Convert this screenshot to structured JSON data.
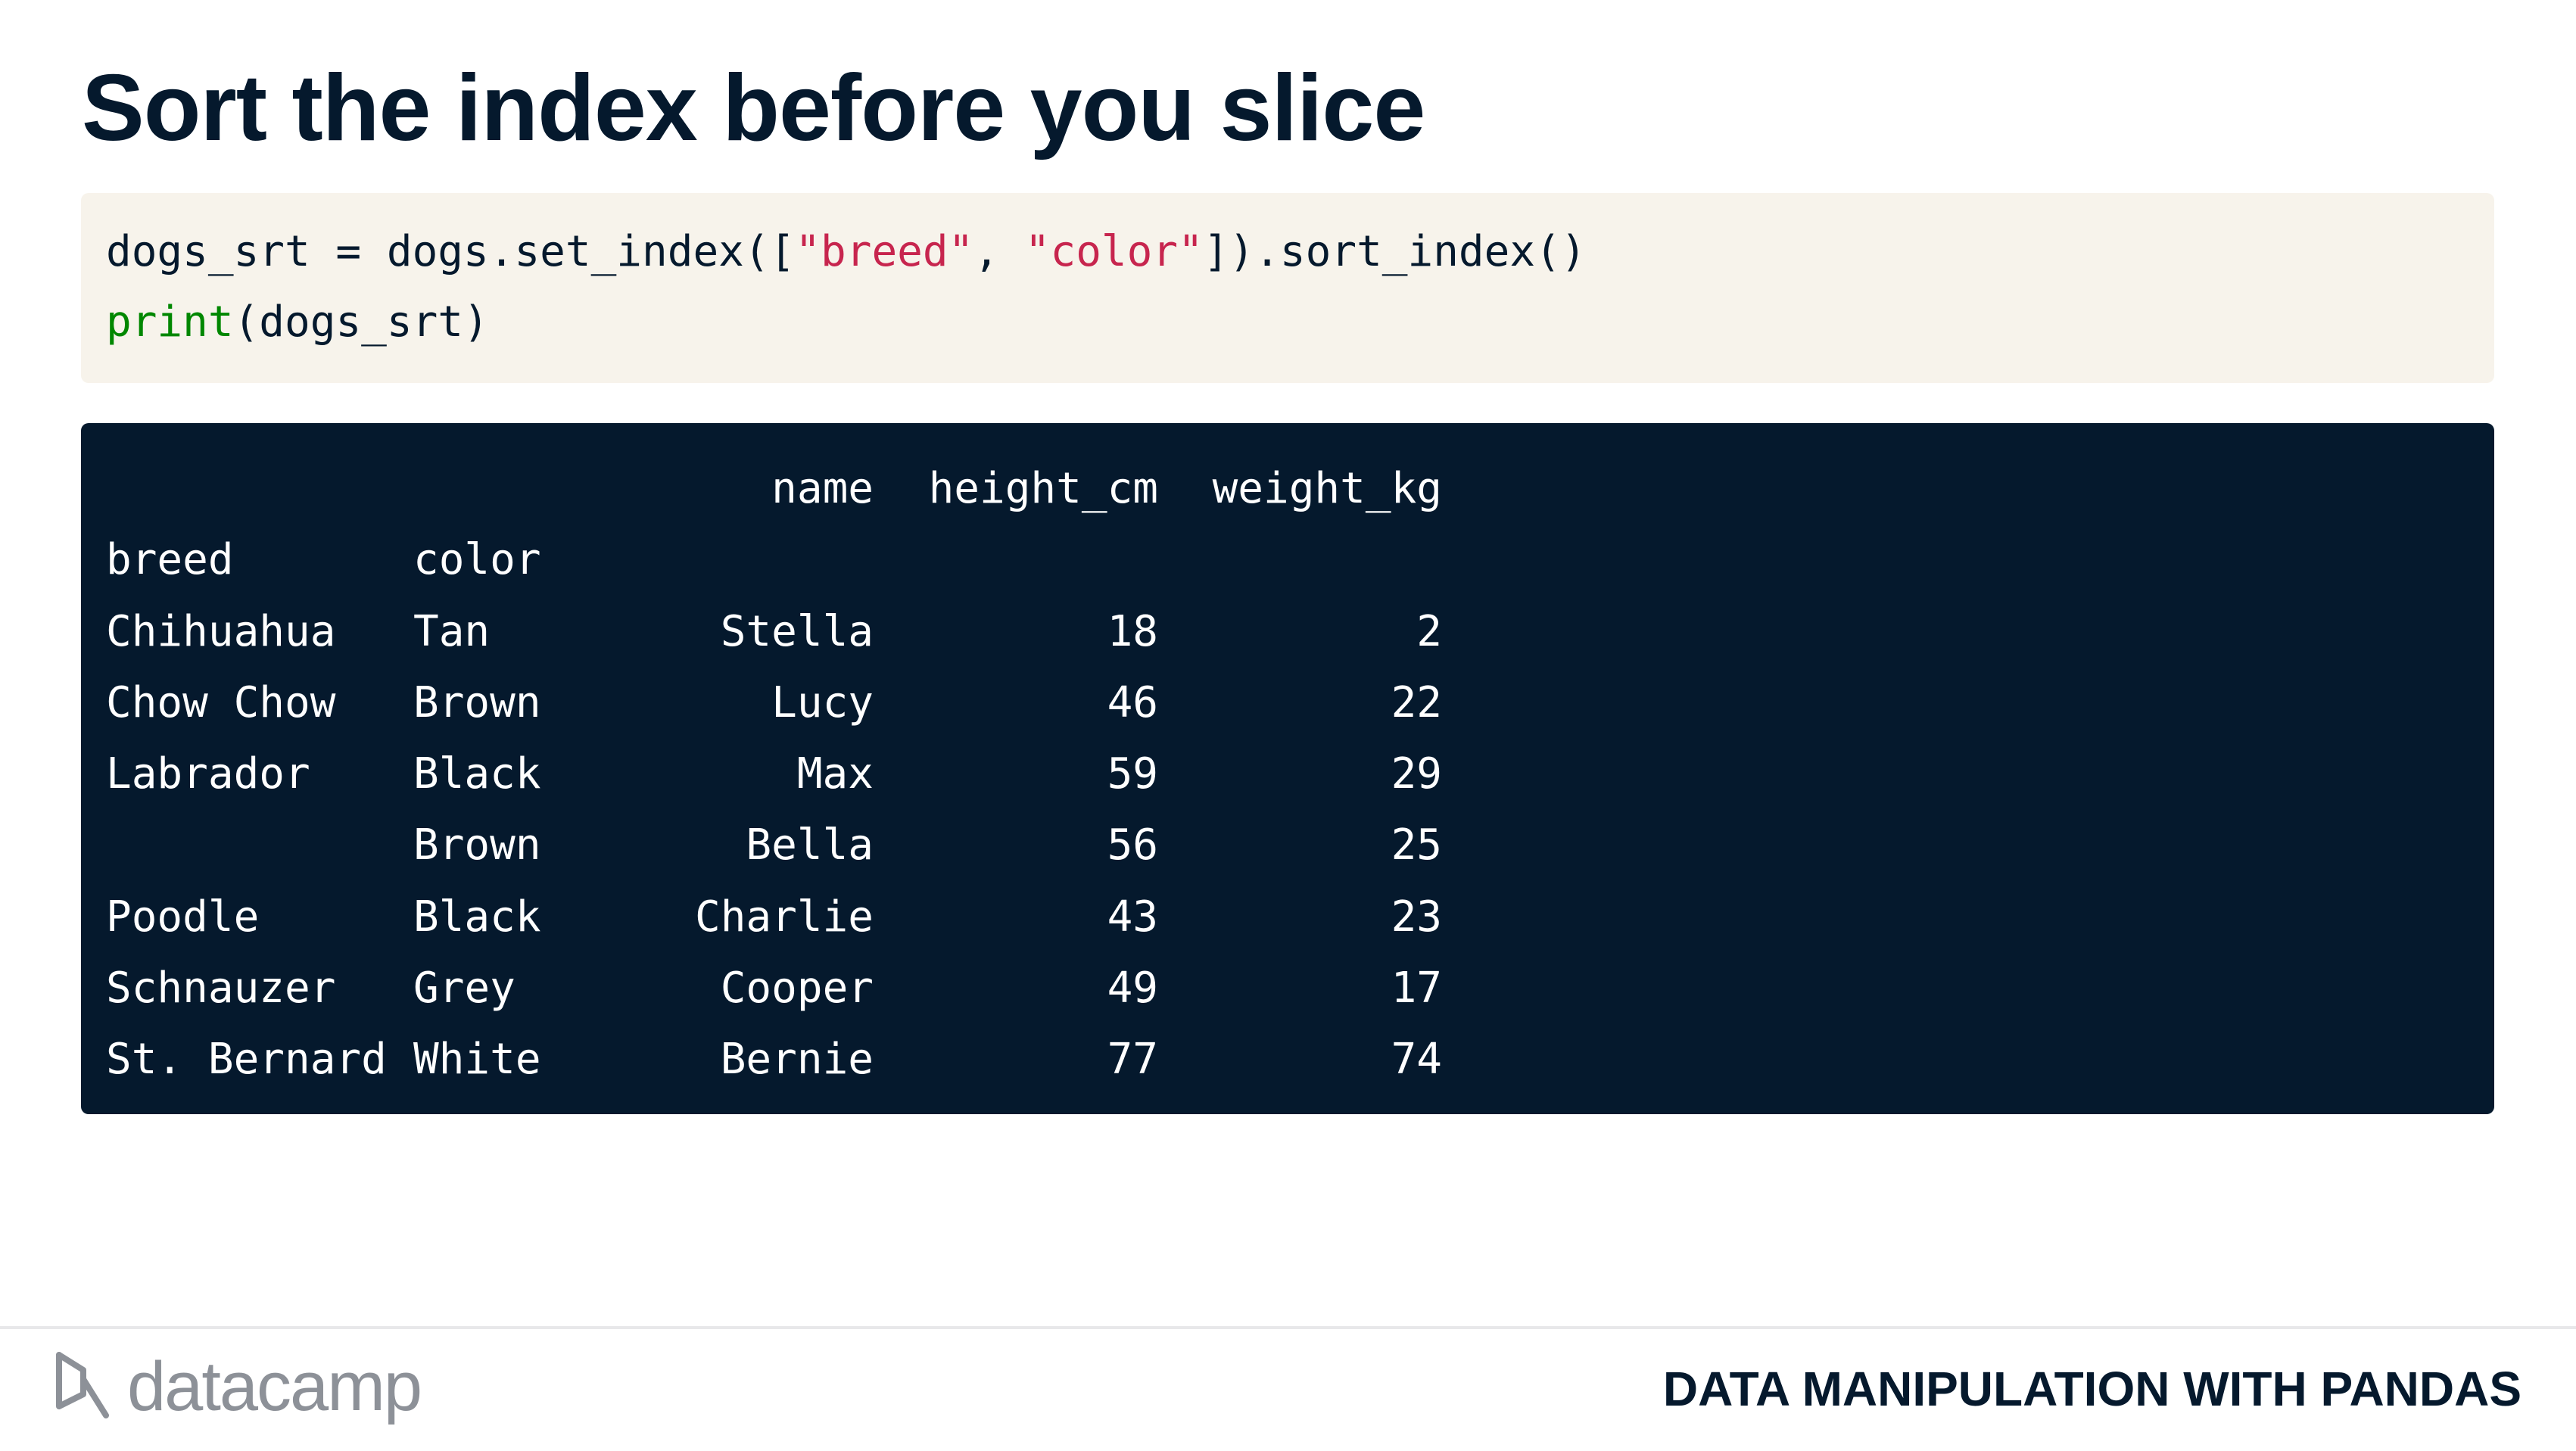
{
  "slide": {
    "title": "Sort the index before you slice"
  },
  "code": {
    "line1": {
      "pre": "dogs_srt = dogs.set_index([",
      "str1": "\"breed\"",
      "mid": ", ",
      "str2": "\"color\"",
      "post": "]).sort_index()"
    },
    "line2": {
      "kw": "print",
      "rest": "(dogs_srt)"
    }
  },
  "output": {
    "header": {
      "name": "name",
      "height_cm": "height_cm",
      "weight_kg": "weight_kg"
    },
    "index_header": {
      "breed": "breed",
      "color": "color"
    },
    "rows": [
      {
        "breed": "Chihuahua",
        "color": "Tan",
        "name": "Stella",
        "height_cm": "18",
        "weight_kg": "2"
      },
      {
        "breed": "Chow Chow",
        "color": "Brown",
        "name": "Lucy",
        "height_cm": "46",
        "weight_kg": "22"
      },
      {
        "breed": "Labrador",
        "color": "Black",
        "name": "Max",
        "height_cm": "59",
        "weight_kg": "29"
      },
      {
        "breed": "",
        "color": "Brown",
        "name": "Bella",
        "height_cm": "56",
        "weight_kg": "25"
      },
      {
        "breed": "Poodle",
        "color": "Black",
        "name": "Charlie",
        "height_cm": "43",
        "weight_kg": "23"
      },
      {
        "breed": "Schnauzer",
        "color": "Grey",
        "name": "Cooper",
        "height_cm": "49",
        "weight_kg": "17"
      },
      {
        "breed": "St. Bernard",
        "color": "White",
        "name": "Bernie",
        "height_cm": "77",
        "weight_kg": "74"
      }
    ]
  },
  "footer": {
    "logo_text": "datacamp",
    "logo_icon": "datacamp-logo-icon",
    "course_title": "DATA MANIPULATION WITH PANDAS"
  },
  "colors": {
    "title": "#05192d",
    "code_bg": "#f7f3eb",
    "string": "#c7254e",
    "keyword": "#008700",
    "output_bg": "#05192d",
    "output_text": "#ffffff",
    "logo_gray": "#8d9198"
  }
}
